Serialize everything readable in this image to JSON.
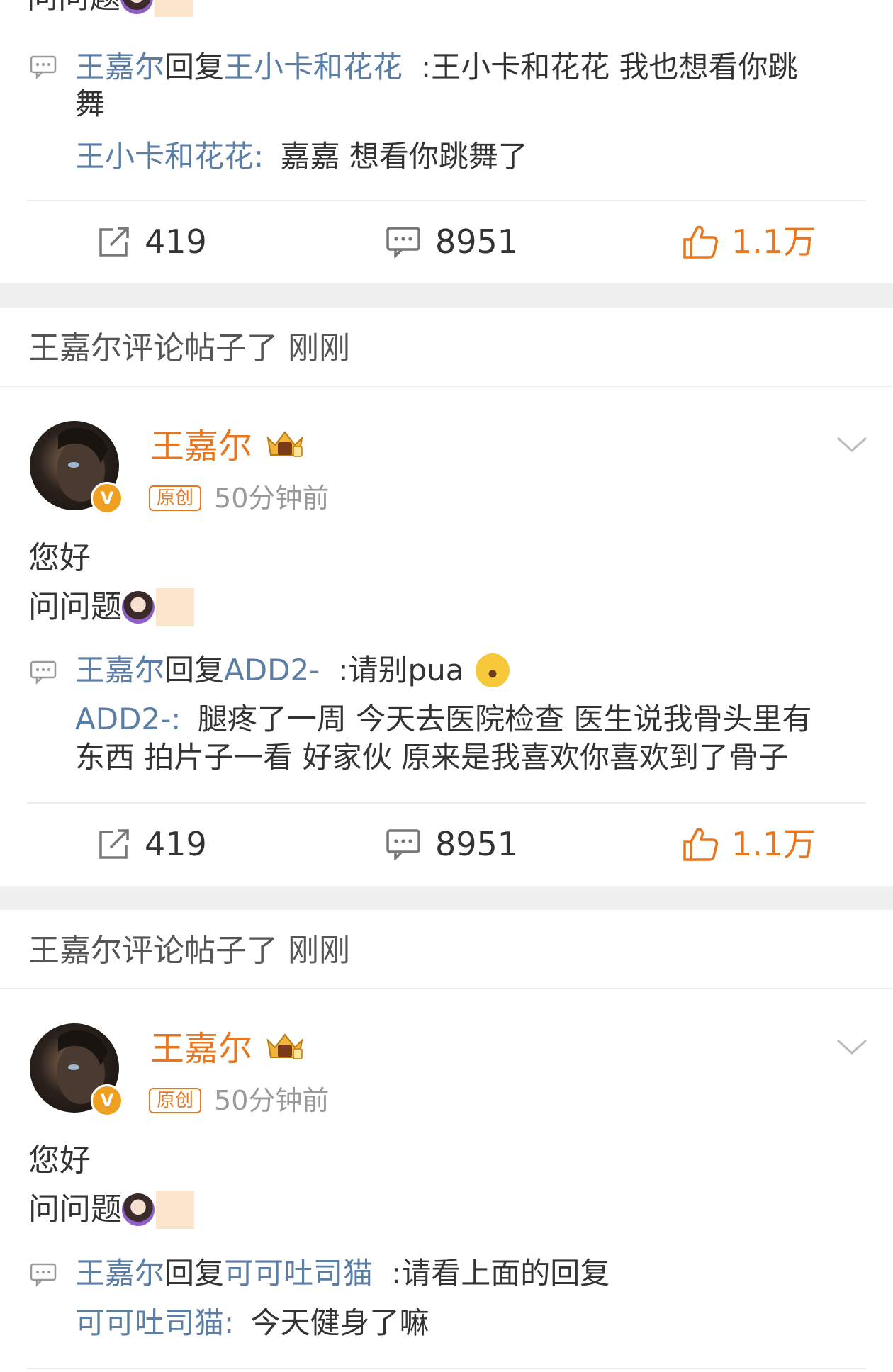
{
  "post1": {
    "content_line2": "问问题",
    "reply": {
      "author": "王嘉尔",
      "reply_word": "回复",
      "target": "王小卡和花花",
      "text_line1": ":王小卡和花花 我也想看你跳",
      "text_line2": "舞"
    },
    "quoted": {
      "author": "王小卡和花花",
      "text": "嘉嘉 想看你跳舞了"
    },
    "actions": {
      "repost": "419",
      "comments": "8951",
      "likes": "1.1万"
    }
  },
  "post2": {
    "section_title": "王嘉尔评论帖子了 刚刚",
    "author": "王嘉尔",
    "verified_badge": "V",
    "original_badge": "原创",
    "time": "50分钟前",
    "content_line1": "您好",
    "content_line2": "问问题",
    "reply": {
      "author": "王嘉尔",
      "reply_word": "回复",
      "target": "ADD2-",
      "text": ":请别pua"
    },
    "quoted": {
      "author": "ADD2-",
      "text_line1": "腿疼了一周 今天去医院检查 医生说我骨头里有",
      "text_line2": "东西 拍片子一看 好家伙 原来是我喜欢你喜欢到了骨子"
    },
    "actions": {
      "repost": "419",
      "comments": "8951",
      "likes": "1.1万"
    }
  },
  "post3": {
    "section_title": "王嘉尔评论帖子了 刚刚",
    "author": "王嘉尔",
    "verified_badge": "V",
    "original_badge": "原创",
    "time": "50分钟前",
    "content_line1": "您好",
    "content_line2": "问问题",
    "reply": {
      "author": "王嘉尔",
      "reply_word": "回复",
      "target": "可可吐司猫",
      "text": ":请看上面的回复"
    },
    "quoted": {
      "author": "可可吐司猫",
      "text": "今天健身了嘛"
    }
  },
  "colors": {
    "link": "#5b7ea7",
    "author_orange": "#e8761f",
    "like_orange": "#e8761f",
    "meta_gray": "#999999",
    "separator": "#efefef"
  },
  "icons": [
    "repost-icon",
    "comment-icon",
    "like-icon",
    "reply-comment-icon",
    "chevron-down-icon",
    "crown-icon",
    "verified-icon",
    "woman-raising-hand-emoji",
    "surprised-face-emoji"
  ]
}
